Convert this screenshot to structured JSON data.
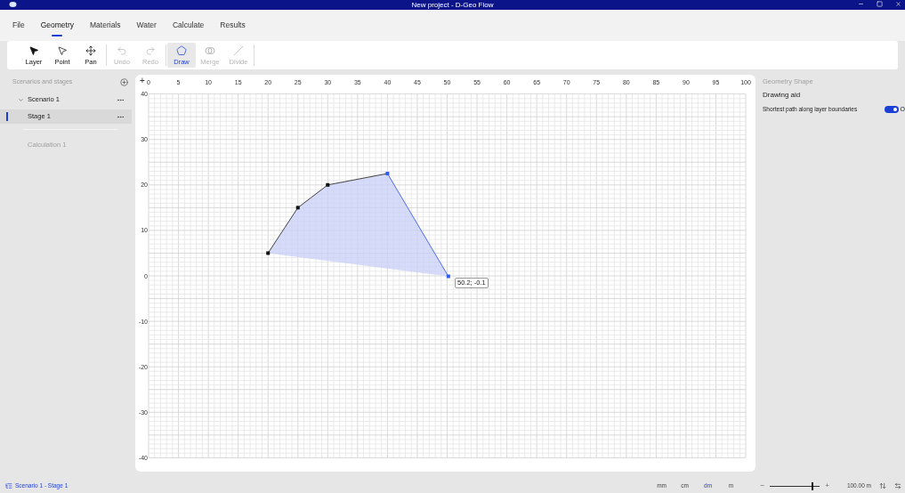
{
  "window": {
    "title": "New project - D-Geo Flow"
  },
  "menu": [
    {
      "label": "File",
      "selected": false
    },
    {
      "label": "Geometry",
      "selected": true
    },
    {
      "label": "Materials",
      "selected": false
    },
    {
      "label": "Water",
      "selected": false
    },
    {
      "label": "Calculate",
      "selected": false
    },
    {
      "label": "Results",
      "selected": false
    }
  ],
  "toolbar": [
    {
      "label": "Layer",
      "kind": "layer",
      "selected": false,
      "disabled": false
    },
    {
      "label": "Point",
      "kind": "point",
      "selected": false,
      "disabled": false
    },
    {
      "label": "Pan",
      "kind": "pan",
      "selected": false,
      "disabled": false
    },
    {
      "label": "Undo",
      "kind": "undo",
      "selected": false,
      "disabled": true
    },
    {
      "label": "Redo",
      "kind": "redo",
      "selected": false,
      "disabled": true
    },
    {
      "label": "Draw",
      "kind": "draw",
      "selected": true,
      "disabled": false
    },
    {
      "label": "Merge",
      "kind": "merge",
      "selected": false,
      "disabled": true
    },
    {
      "label": "Divide",
      "kind": "divide",
      "selected": false,
      "disabled": true
    }
  ],
  "scenarios_panel": {
    "title": "Scenarios and stages",
    "tree": [
      {
        "label": "Scenario 1",
        "expanded": true,
        "selected": false,
        "children": [
          {
            "label": "Stage 1",
            "selected": true
          }
        ]
      }
    ],
    "calculations": [
      {
        "label": "Calculation 1",
        "disabled": true
      }
    ]
  },
  "canvas": {
    "corner": "+",
    "x_ticks": [
      "0",
      "5",
      "10",
      "15",
      "20",
      "25",
      "30",
      "35",
      "40",
      "45",
      "50",
      "55",
      "60",
      "65",
      "70",
      "75",
      "80",
      "85",
      "90",
      "95",
      "100"
    ],
    "y_ticks": [
      "40",
      "30",
      "20",
      "10",
      "0",
      "-10",
      "-20",
      "-30",
      "-40"
    ],
    "tooltip": "50.2; -0.1"
  },
  "properties": {
    "title": "Geometry Shape",
    "section": "Drawing aid",
    "settings": [
      {
        "label": "Shortest path along layer boundaries",
        "on": true,
        "state_label": "O"
      }
    ]
  },
  "status_bar": {
    "breadcrumb": "Scenario 1 - Stage 1",
    "units": [
      {
        "label": "mm",
        "selected": false
      },
      {
        "label": "cm",
        "selected": false
      },
      {
        "label": "dm",
        "selected": true
      },
      {
        "label": "m",
        "selected": false
      }
    ],
    "zoom": {
      "minus": "−",
      "plus": "+",
      "level": 0.85
    },
    "scale": "100.00 m"
  }
}
